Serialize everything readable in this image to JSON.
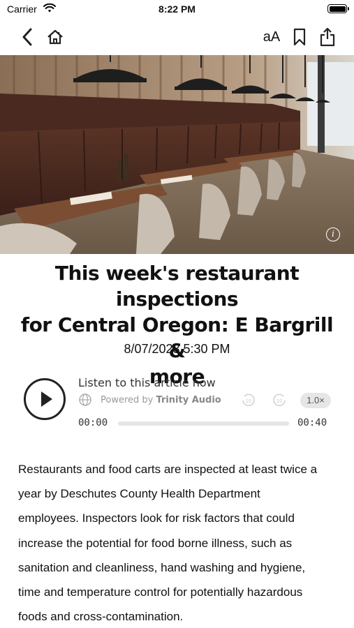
{
  "status_bar": {
    "carrier": "Carrier",
    "time": "8:22 PM"
  },
  "nav": {
    "back_icon": "chevron-left-icon",
    "home_icon": "home-icon",
    "text_size_label": "aA",
    "bookmark_icon": "bookmark-icon",
    "share_icon": "share-icon"
  },
  "hero": {
    "image_description": "restaurant interior with booth seating and pendant lights",
    "info_icon": "info-icon"
  },
  "article": {
    "headline_lines": [
      "This week's restaurant inspections",
      "for Central Oregon: E Bargrill &",
      "more"
    ],
    "dateline": "8/07/2023 5:30 PM",
    "body_lines": [
      "Restaurants and food carts are inspected at least twice a",
      "year by Deschutes County Health Department",
      "employees. Inspectors look for risk factors that could",
      "increase the potential for food borne illness, such as",
      "sanitation and cleanliness, hand washing and hygiene,",
      "time and temperature control for potentially hazardous",
      "foods and cross-contamination."
    ]
  },
  "player": {
    "listen_label": "Listen to this article now",
    "powered_by": "Powered by",
    "brand": "Trinity Audio",
    "skip_back_label": "10",
    "skip_forward_label": "10",
    "speed": "1.0×",
    "time_current": "00:00",
    "time_total": "00:40",
    "progress_fraction": 0
  },
  "colors": {
    "text": "#111111",
    "muted": "#999999",
    "track": "#e5e5e5",
    "speed_bg": "#e6e6e6"
  }
}
